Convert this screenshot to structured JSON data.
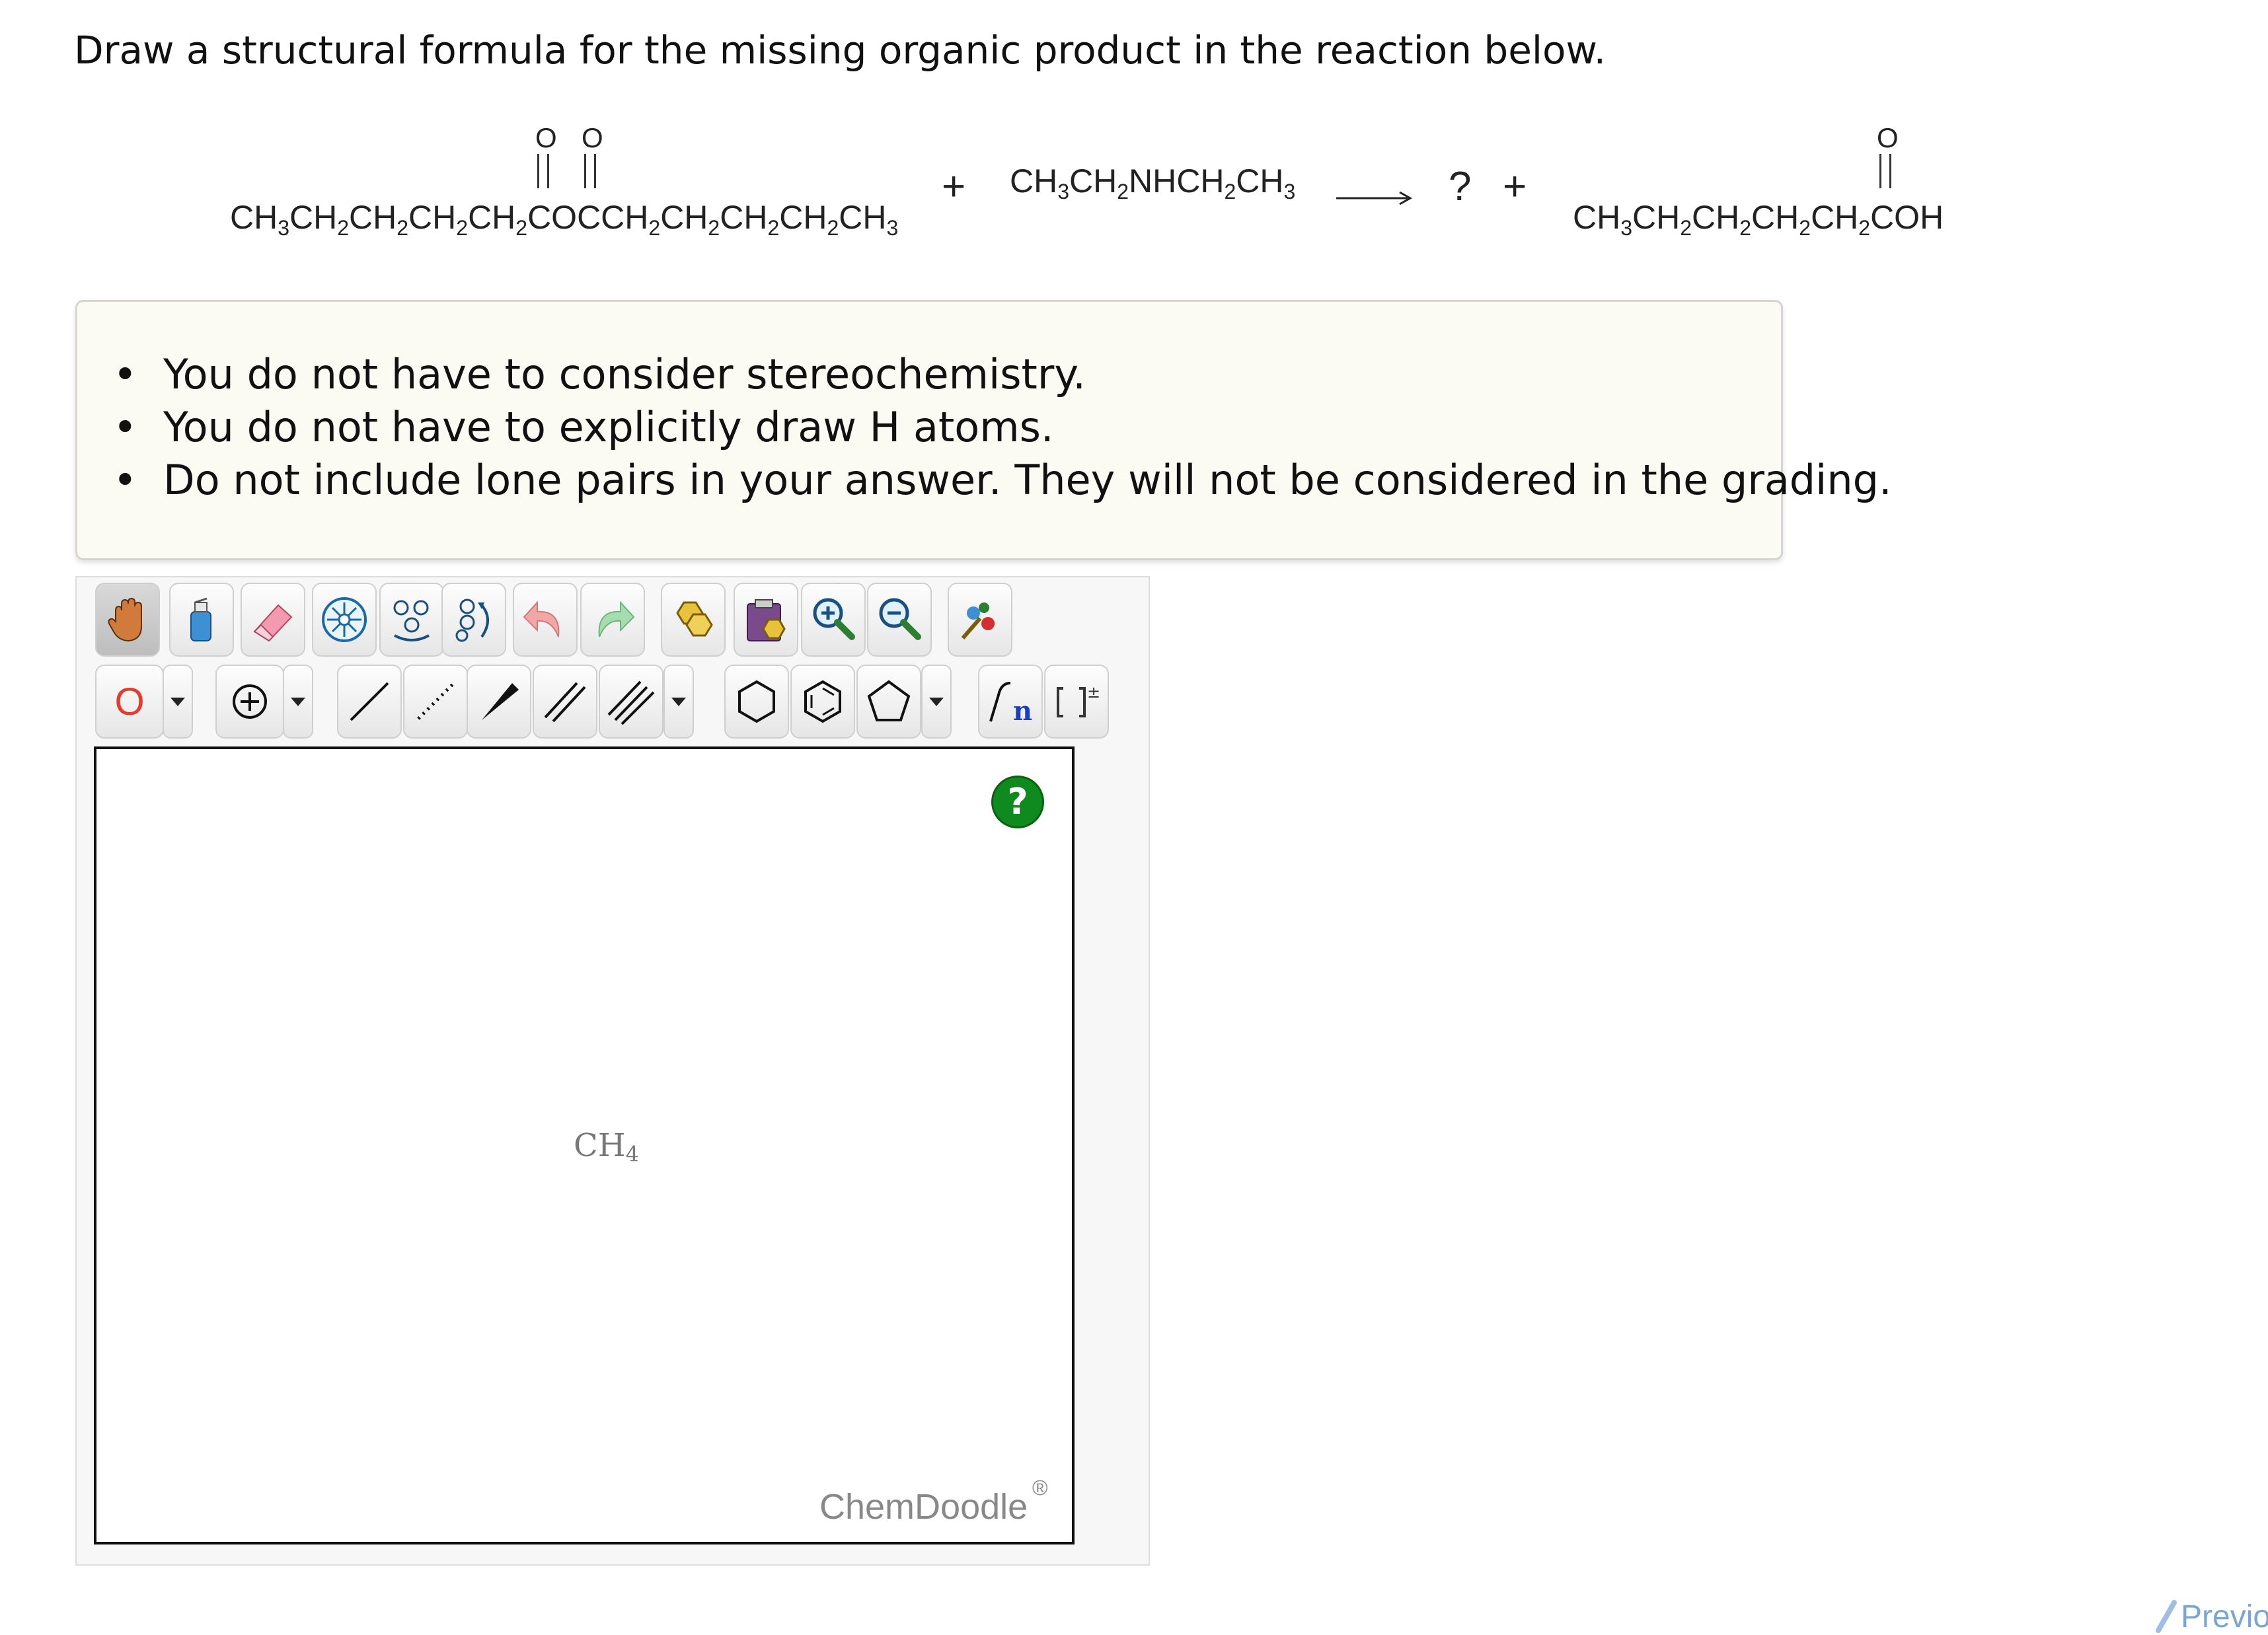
{
  "question": "Draw a structural formula for the missing organic product in the reaction below.",
  "reaction": {
    "reactant1": {
      "left": "CH3CH2CH2CH2CH2C",
      "middle": "O",
      "middle2": "C",
      "right": "CH2CH2CH2CH2CH3",
      "carbonyl_o_1": "O",
      "carbonyl_o_2": "O"
    },
    "plus1": "+",
    "reactant2": "CH3CH2NHCH2CH3",
    "arrow": "→",
    "unknown": "?",
    "plus2": "+",
    "product2": {
      "chain": "CH3CH2CH2CH2CH2C",
      "tail": "OH",
      "carbonyl_o": "O"
    }
  },
  "hints": [
    "You do not have to consider stereochemistry.",
    "You do not have to explicitly draw H atoms.",
    "Do not include lone pairs in your answer. They will not be considered in the grading."
  ],
  "editor": {
    "element_label": "O",
    "canvas_molecule": "CH4",
    "help_label": "?",
    "brand": "ChemDoodle",
    "brand_mark": "®",
    "toolbar_row1": [
      "hand-tool-icon",
      "clear-bottle-icon",
      "eraser-icon",
      "center-icon",
      "flip-icon",
      "rotate-icon",
      "undo-icon",
      "redo-icon",
      "copy-icon",
      "paste-icon",
      "zoom-in-icon",
      "zoom-out-icon",
      "clean-icon"
    ],
    "toolbar_row2": [
      "element-O",
      "charge-icon",
      "single-bond-icon",
      "dashed-bond-icon",
      "wedge-bond-icon",
      "double-bond-icon",
      "triple-bond-icon",
      "hexagon-ring-icon",
      "benzene-ring-icon",
      "pentagon-ring-icon",
      "chain-icon",
      "bracket-icon"
    ],
    "element_color": "#e53a2c",
    "help_color": "#0f8a1e"
  },
  "navigation": {
    "previous_label": "Previo"
  }
}
